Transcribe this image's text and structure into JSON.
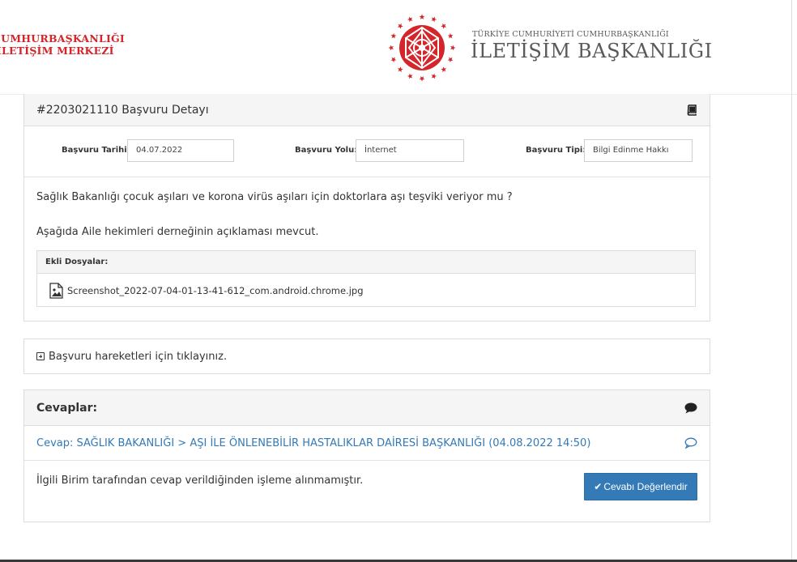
{
  "header": {
    "left_brand_line1": "CUMHURBAŞKANLIĞI",
    "left_brand_line2": "İLETİŞİM MERKEZİ",
    "right_brand_small": "TÜRKİYE CUMHURİYETİ CUMHURBAŞKANLIĞI",
    "right_brand_big": "İLETİŞİM BAŞKANLIĞI",
    "brand_color": "#d4252b"
  },
  "application": {
    "title": "#2203021110 Başvuru Detayı",
    "title_icon": "book-icon",
    "fields": {
      "date_label": "Başvuru Tarihi:",
      "date_value": "04.07.2022",
      "channel_label": "Başvuru Yolu:",
      "channel_value": "İnternet",
      "type_label": "Başvuru Tipi:",
      "type_value": "Bilgi Edinme Hakkı"
    },
    "question_line1": "Sağlık Bakanlığı çocuk aşıları ve korona virüs aşıları için doktorlara aşı teşviki veriyor mu ?",
    "question_line2": "Aşağıda Aile hekimleri derneğinin açıklaması mevcut.",
    "attachments_label": "Ekli Dosyalar:",
    "attachments": [
      {
        "file_name": "Screenshot_2022-07-04-01-13-41-612_com.android.chrome.jpg",
        "icon": "image-file-icon"
      }
    ]
  },
  "history": {
    "toggle_label": "Başvuru hareketleri için tıklayınız."
  },
  "answers": {
    "title": "Cevaplar:",
    "title_icon": "comment-icon",
    "answer_header": "Cevap: SAĞLIK BAKANLIĞI > AŞI İLE ÖNLENEBİLİR HASTALIKLAR DAİRESİ BAŞKANLIĞI (04.08.2022 14:50)",
    "answer_icon": "comment-outline-icon",
    "answer_text": "İlgili Birim tarafından cevap verildiğinden işleme alınmamıştır.",
    "rate_button_label": "Cevabı Değerlendir",
    "link_color": "#337ab7",
    "button_color": "#337ab7"
  }
}
